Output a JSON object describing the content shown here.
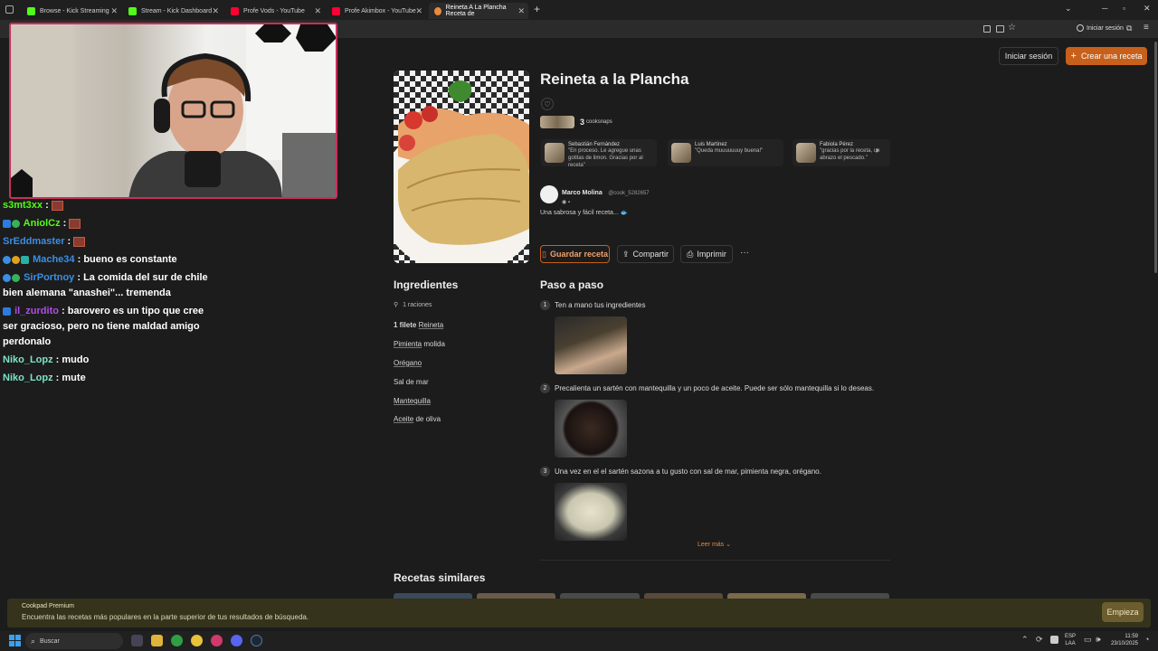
{
  "browser": {
    "tabs": [
      {
        "label": "Browse - Kick Streaming",
        "color": "#53fc18"
      },
      {
        "label": "Stream - Kick Dashboard",
        "color": "#53fc18"
      },
      {
        "label": "Profe Vods - YouTube",
        "color": "#ff0033"
      },
      {
        "label": "Profe Akimbox - YouTube",
        "color": "#ff0033"
      },
      {
        "label": "Reineta A La Plancha Receta de",
        "color": "#e98a3c"
      }
    ],
    "new_tab": "+",
    "signin_label": "Iniciar sesión"
  },
  "header": {
    "login_label": "Iniciar sesión",
    "create_label": "Crear una receta",
    "create_icon": "+"
  },
  "recipe": {
    "title": "Reineta a la Plancha",
    "cooksnaps_count": "3",
    "cooksnaps_label": "cooksnaps",
    "cooksnaps": [
      {
        "name": "Sebastián Fernández",
        "quote": "\"En proceso. Le agregue unas gotitas de limon. Gracias por al receta\""
      },
      {
        "name": "Luis Martinez",
        "quote": "\"Queda muuuuuuuy buena!\""
      },
      {
        "name": "Fabiola Pérez",
        "quote": "\"gracias por la receta, un abrazo el pescado.\""
      }
    ],
    "author_name": "Marco Molina",
    "author_handle": "@cook_5282657",
    "description": "Una sabrosa y fácil receta... 🐟",
    "actions": {
      "save": "Guardar receta",
      "share": "Compartir",
      "print": "Imprimir",
      "more": "···"
    }
  },
  "ingredients": {
    "title": "Ingredientes",
    "servings": "1 raciones",
    "items": [
      {
        "qty": "1 filete",
        "name": "Reineta",
        "rest": ""
      },
      {
        "qty": "",
        "name": "Pimienta",
        "rest": " molida"
      },
      {
        "qty": "",
        "name": "Orégano",
        "rest": ""
      },
      {
        "qty": "",
        "name": "",
        "rest": "Sal de mar"
      },
      {
        "qty": "",
        "name": "Mantequilla",
        "rest": ""
      },
      {
        "qty": "",
        "name": "Aceite",
        "rest": " de oliva"
      }
    ]
  },
  "steps": {
    "title": "Paso a paso",
    "items": [
      {
        "num": "1",
        "text": "Ten a mano tus ingredientes"
      },
      {
        "num": "2",
        "text": "Precalienta un sartén con mantequilla y un poco de aceite. Puede ser sólo mantequilla si lo deseas."
      },
      {
        "num": "3",
        "text": "Una vez en el el sartén sazona a tu gusto con sal de mar, pimienta negra, orégano."
      }
    ],
    "read_more": "Leer más"
  },
  "similar": {
    "title": "Recetas similares"
  },
  "banner": {
    "title": "Cookpad Premium",
    "text": "Encuentra las recetas más populares en la parte superior de tus resultados de búsqueda.",
    "cta": "Empieza"
  },
  "chat": [
    {
      "user": "s3mt3xx",
      "color": "#53fc18",
      "text": "",
      "emote": true
    },
    {
      "user": "AniolCz",
      "color": "#53fc18",
      "text": "",
      "emote": true
    },
    {
      "user": "SrEddmaster",
      "color": "#3a8ee6",
      "text": "",
      "emote": true
    },
    {
      "user": "Mache34",
      "color": "#3a8ee6",
      "text": "bueno es constante",
      "emote": false
    },
    {
      "user": "SirPortnoy",
      "color": "#3a8ee6",
      "text": "La comida del sur de chile bien alemana \"anashei\"... tremenda",
      "emote": false
    },
    {
      "user": "il_zurdito",
      "color": "#b04ee6",
      "text": "barovero es un tipo que cree ser gracioso, pero no tiene maldad amigo perdonalo",
      "emote": false
    },
    {
      "user": "Niko_Lopz",
      "color": "#7fe3c7",
      "text": "mudo",
      "emote": false
    },
    {
      "user": "Niko_Lopz",
      "color": "#7fe3c7",
      "text": "mute",
      "emote": false
    }
  ],
  "taskbar": {
    "search_label": "Buscar",
    "lang": "ESP",
    "lang2": "LAA",
    "time": "11:59",
    "date": "23/10/2025"
  }
}
